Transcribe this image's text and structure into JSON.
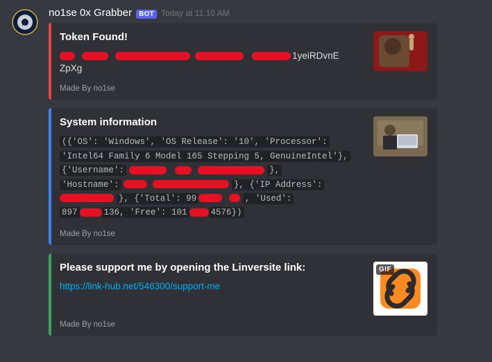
{
  "header": {
    "username": "no1se 0x Grabber",
    "bot_tag": "BOT",
    "timestamp": "Today at 11:10 AM"
  },
  "embeds": {
    "token": {
      "title": "Token Found!",
      "line2_suffix": "1yeiRDvnE",
      "line3": "ZpXg",
      "footer": "Made By no1se"
    },
    "sysinfo": {
      "title": "System information",
      "line1": "({'OS': 'Windows', 'OS Release': '10', 'Processor':",
      "line2": "'Intel64 Family 6 Model 165 Stepping 5, GenuineIntel'},",
      "line3_a": "{'Username':",
      "line3_b": "},",
      "line4_a": "'Hostname':",
      "line4_b": "}, {'IP Address':",
      "line5_a": "}, {'Total': 99",
      "line5_b": ", 'Used':",
      "line6_a": "897",
      "line6_b": "136, 'Free': 101",
      "line6_c": "4576})",
      "footer": "Made By no1se"
    },
    "support": {
      "title": "Please support me by opening the Linversite link:",
      "link": "https://link-hub.net/546300/support-me",
      "gif_tag": "GIF",
      "footer": "Made By no1se"
    }
  }
}
